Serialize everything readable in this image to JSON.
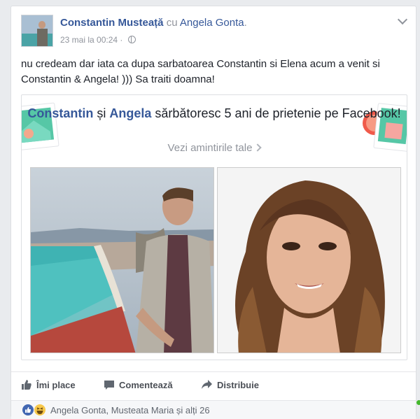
{
  "post": {
    "author": "Constantin Musteață",
    "with_word": "cu",
    "tagged": "Angela Gonta",
    "tagged_suffix": ".",
    "timestamp": "23 mai la 00:24",
    "separator": "·",
    "text": "nu credeam dar iata ca dupa sarbatoarea Constantin si Elena acum a venit si Constantin & Angela! ))) Sa traiti doamna!"
  },
  "memory": {
    "name1": "Constantin",
    "and_word": "și",
    "name2": "Angela",
    "title_rest": "sărbătoresc 5 ani de prietenie pe Facebook!",
    "link": "Vezi amintirile tale"
  },
  "actions": {
    "like": "Îmi place",
    "comment": "Comentează",
    "share": "Distribuie"
  },
  "reactions": {
    "text": "Angela Gonta, Musteata Maria și alți 26",
    "icons": [
      "like-reaction-icon",
      "haha-reaction-icon"
    ]
  },
  "colors": {
    "link_blue": "#365899",
    "meta_gray": "#90949c",
    "like_blue": "#4267b2",
    "haha_yellow": "#f7c84b"
  }
}
